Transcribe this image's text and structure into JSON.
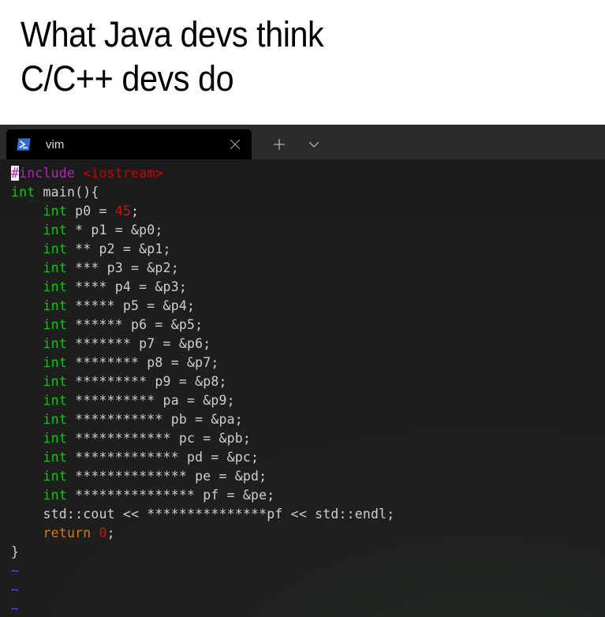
{
  "caption": {
    "line1": "What Java devs think",
    "line2": "C/C++ devs do"
  },
  "colors": {
    "page_background": "#ffffff",
    "caption_text": "#000000",
    "tabstrip_background": "#2b2b2b",
    "active_tab_background": "#000000",
    "terminal_background": "#1e1e1e",
    "keyword_green": "#15c115",
    "preproc_magenta": "#a92ca9",
    "string_red": "#cc0000",
    "number_red": "#cc1111",
    "return_orange": "#cd7b1b",
    "plain_text": "#cfcfcf",
    "tilde_blue": "#1f4ff0",
    "cursor_block": "#f2f2f2",
    "powershell_blue": "#2d6fd4"
  },
  "terminal": {
    "app": "Windows Terminal",
    "tab": {
      "icon": "powershell-icon",
      "title": "vim",
      "close_label": "✕"
    },
    "controls": {
      "new_tab_label": "+",
      "dropdown_label": "⌄"
    }
  },
  "editor": {
    "name": "vim",
    "language": "cpp",
    "cursor": {
      "line": 1,
      "column": 1,
      "char": "#"
    },
    "lines": [
      [
        {
          "t": "#",
          "c": "cursor"
        },
        {
          "t": "include ",
          "c": "pre"
        },
        {
          "t": "<iostream>",
          "c": "str"
        }
      ],
      [
        {
          "t": "int",
          "c": "kw"
        },
        {
          "t": " main(){",
          "c": "plain"
        }
      ],
      [
        {
          "t": "    ",
          "c": "plain"
        },
        {
          "t": "int",
          "c": "kw"
        },
        {
          "t": " p0 = ",
          "c": "plain"
        },
        {
          "t": "45",
          "c": "num"
        },
        {
          "t": ";",
          "c": "plain"
        }
      ],
      [
        {
          "t": "    ",
          "c": "plain"
        },
        {
          "t": "int",
          "c": "kw"
        },
        {
          "t": " * p1 = &p0;",
          "c": "plain"
        }
      ],
      [
        {
          "t": "    ",
          "c": "plain"
        },
        {
          "t": "int",
          "c": "kw"
        },
        {
          "t": " ** p2 = &p1;",
          "c": "plain"
        }
      ],
      [
        {
          "t": "    ",
          "c": "plain"
        },
        {
          "t": "int",
          "c": "kw"
        },
        {
          "t": " *** p3 = &p2;",
          "c": "plain"
        }
      ],
      [
        {
          "t": "    ",
          "c": "plain"
        },
        {
          "t": "int",
          "c": "kw"
        },
        {
          "t": " **** p4 = &p3;",
          "c": "plain"
        }
      ],
      [
        {
          "t": "    ",
          "c": "plain"
        },
        {
          "t": "int",
          "c": "kw"
        },
        {
          "t": " ***** p5 = &p4;",
          "c": "plain"
        }
      ],
      [
        {
          "t": "    ",
          "c": "plain"
        },
        {
          "t": "int",
          "c": "kw"
        },
        {
          "t": " ****** p6 = &p5;",
          "c": "plain"
        }
      ],
      [
        {
          "t": "    ",
          "c": "plain"
        },
        {
          "t": "int",
          "c": "kw"
        },
        {
          "t": " ******* p7 = &p6;",
          "c": "plain"
        }
      ],
      [
        {
          "t": "    ",
          "c": "plain"
        },
        {
          "t": "int",
          "c": "kw"
        },
        {
          "t": " ******** p8 = &p7;",
          "c": "plain"
        }
      ],
      [
        {
          "t": "    ",
          "c": "plain"
        },
        {
          "t": "int",
          "c": "kw"
        },
        {
          "t": " ********* p9 = &p8;",
          "c": "plain"
        }
      ],
      [
        {
          "t": "    ",
          "c": "plain"
        },
        {
          "t": "int",
          "c": "kw"
        },
        {
          "t": " ********** pa = &p9;",
          "c": "plain"
        }
      ],
      [
        {
          "t": "    ",
          "c": "plain"
        },
        {
          "t": "int",
          "c": "kw"
        },
        {
          "t": " *********** pb = &pa;",
          "c": "plain"
        }
      ],
      [
        {
          "t": "    ",
          "c": "plain"
        },
        {
          "t": "int",
          "c": "kw"
        },
        {
          "t": " ************ pc = &pb;",
          "c": "plain"
        }
      ],
      [
        {
          "t": "    ",
          "c": "plain"
        },
        {
          "t": "int",
          "c": "kw"
        },
        {
          "t": " ************* pd = &pc;",
          "c": "plain"
        }
      ],
      [
        {
          "t": "    ",
          "c": "plain"
        },
        {
          "t": "int",
          "c": "kw"
        },
        {
          "t": " ************** pe = &pd;",
          "c": "plain"
        }
      ],
      [
        {
          "t": "    ",
          "c": "plain"
        },
        {
          "t": "int",
          "c": "kw"
        },
        {
          "t": " *************** pf = &pe;",
          "c": "plain"
        }
      ],
      [
        {
          "t": "    std::cout << ***************pf << std::endl;",
          "c": "plain"
        }
      ],
      [
        {
          "t": "    ",
          "c": "plain"
        },
        {
          "t": "return",
          "c": "ret"
        },
        {
          "t": " ",
          "c": "plain"
        },
        {
          "t": "0",
          "c": "num"
        },
        {
          "t": ";",
          "c": "plain"
        }
      ],
      [
        {
          "t": "}",
          "c": "plain"
        }
      ],
      [
        {
          "t": "~",
          "c": "tilde"
        }
      ],
      [
        {
          "t": "~",
          "c": "tilde"
        }
      ],
      [
        {
          "t": "~",
          "c": "tilde"
        }
      ]
    ]
  }
}
